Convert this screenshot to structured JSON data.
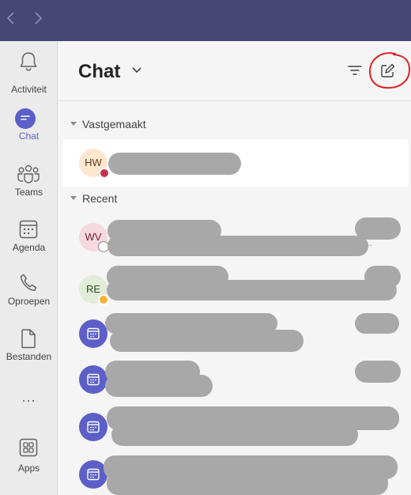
{
  "sidebar": {
    "items": [
      {
        "label": "Activiteit",
        "icon": "bell-icon"
      },
      {
        "label": "Chat",
        "icon": "chat-icon"
      },
      {
        "label": "Teams",
        "icon": "teams-icon"
      },
      {
        "label": "Agenda",
        "icon": "calendar-icon"
      },
      {
        "label": "Oproepen",
        "icon": "phone-icon"
      },
      {
        "label": "Bestanden",
        "icon": "file-icon"
      },
      {
        "label": "Apps",
        "icon": "apps-icon"
      }
    ],
    "more": "..."
  },
  "header": {
    "title": "Chat"
  },
  "sections": {
    "pinned": "Vastgemaakt",
    "recent": "Recent"
  },
  "chats": {
    "pinned": [
      {
        "initials": "HW",
        "presence": "busy"
      }
    ],
    "recent": [
      {
        "initials": "WV",
        "presence": "offline",
        "trail": ".."
      },
      {
        "initials": "RE",
        "presence": "away"
      },
      {
        "initials": "",
        "type": "meeting"
      },
      {
        "initials": "",
        "type": "meeting"
      },
      {
        "initials": "",
        "type": "meeting"
      },
      {
        "initials": "",
        "type": "meeting"
      }
    ]
  },
  "colors": {
    "titlebar": "#464775",
    "accent": "#5b5fc7",
    "annotation": "#e02020"
  }
}
